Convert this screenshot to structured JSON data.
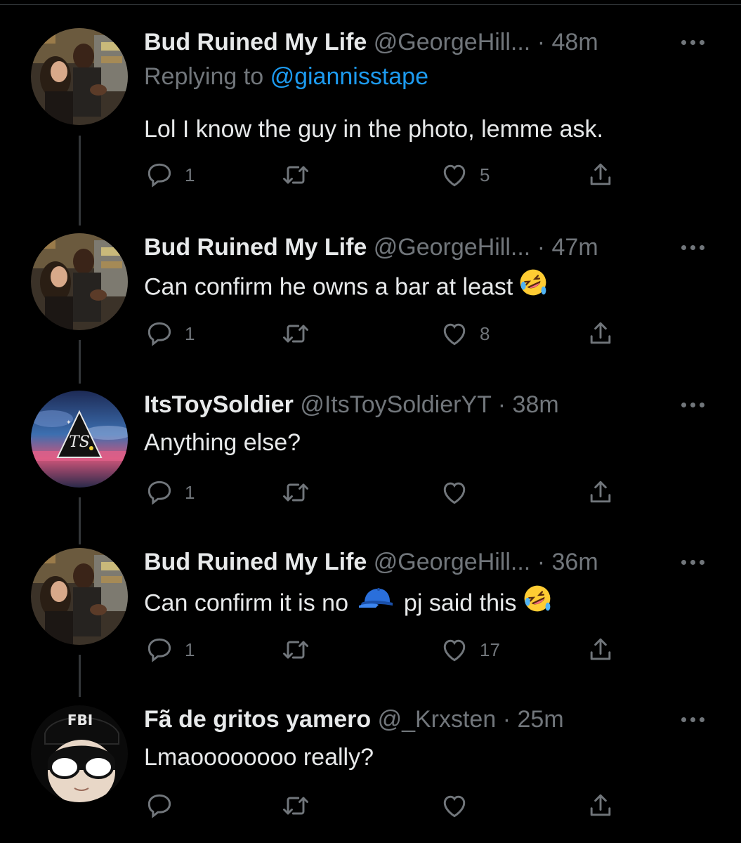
{
  "tweets": [
    {
      "display_name": "Bud Ruined My Life",
      "handle": "@GeorgeHill...",
      "time": "48m",
      "replying_to_prefix": "Replying to",
      "replying_to_handle": "@giannisstape",
      "text": "Lol I know the guy in the photo, lemme ask.",
      "replies": "1",
      "retweets": "",
      "likes": "5"
    },
    {
      "display_name": "Bud Ruined My Life",
      "handle": "@GeorgeHill...",
      "time": "47m",
      "text": "Can confirm he owns a bar at least",
      "text_emoji": "rolling-on-floor-laughing-emoji",
      "replies": "1",
      "retweets": "",
      "likes": "8"
    },
    {
      "display_name": "ItsToySoldier",
      "handle": "@ItsToySoldierYT",
      "time": "38m",
      "text": "Anything else?",
      "replies": "1",
      "retweets": "",
      "likes": ""
    },
    {
      "display_name": "Bud Ruined My Life",
      "handle": "@GeorgeHill...",
      "time": "36m",
      "text_part1": "Can confirm it is no",
      "text_part2": "pj said this",
      "text_emojis": [
        "blue-cap-emoji",
        "rolling-on-floor-laughing-emoji"
      ],
      "replies": "1",
      "retweets": "",
      "likes": "17"
    },
    {
      "display_name": "Fã de gritos yamero",
      "handle": "@_Krxsten",
      "time": "25m",
      "text": "Lmaoooooooo really?",
      "replies": "",
      "retweets": "",
      "likes": ""
    }
  ],
  "separator": "·",
  "icons": {
    "reply": "speech-bubble-icon",
    "retweet": "retweet-arrows-icon",
    "like": "heart-outline-icon",
    "share": "share-upload-icon",
    "more": "more-dots-icon"
  },
  "colors": {
    "background": "#000000",
    "text": "#e7e9ea",
    "muted": "#71767b",
    "link": "#1d9bf0",
    "thread_line": "#333639"
  }
}
